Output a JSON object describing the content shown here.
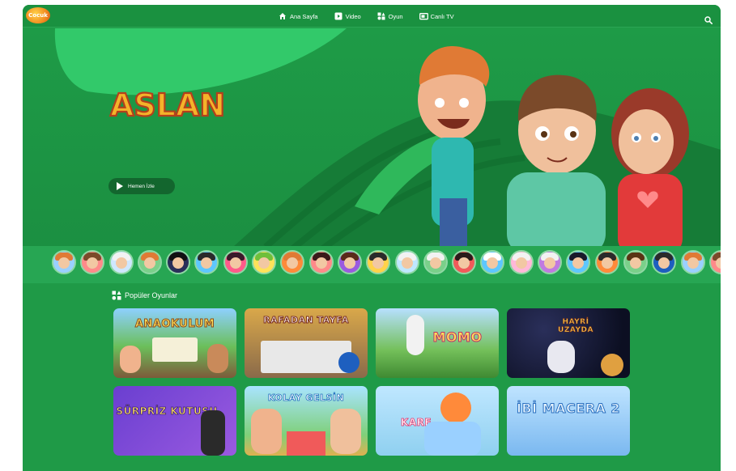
{
  "navbar": {
    "logo_text": "Cocuk",
    "items": [
      {
        "label": "Ana Sayfa",
        "icon": "home-icon"
      },
      {
        "label": "Video",
        "icon": "video-icon"
      },
      {
        "label": "Oyun",
        "icon": "game-icon"
      },
      {
        "label": "Canlı TV",
        "icon": "tv-icon"
      }
    ],
    "search_icon": "search-icon"
  },
  "hero": {
    "show_title": "ASLAN",
    "watch_label": "Hemen İzle"
  },
  "characters": {
    "count": 24
  },
  "popular_games": {
    "title": "Popüler Oyunlar",
    "cards": [
      {
        "title": "ANAOKULUM"
      },
      {
        "title": "RAFADAN TAYFA"
      },
      {
        "title": "MOMO"
      },
      {
        "title": "HAYRİ UZAYDA"
      },
      {
        "title": "SÜRPRİZ KUTUSU"
      },
      {
        "title": "KOLAY GELSİN"
      },
      {
        "title": "KARE"
      },
      {
        "title": "İBİ MACERA 2"
      }
    ]
  },
  "colors": {
    "background": "#1f9a47",
    "accent": "#27a653",
    "white": "#ffffff"
  }
}
